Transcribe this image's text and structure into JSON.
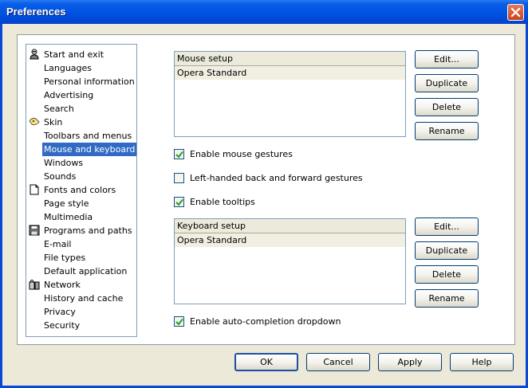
{
  "window": {
    "title": "Preferences"
  },
  "tree": {
    "items": [
      {
        "label": "Start and exit",
        "icon": "person-icon"
      },
      {
        "label": "Languages"
      },
      {
        "label": "Personal information"
      },
      {
        "label": "Advertising"
      },
      {
        "label": "Search"
      },
      {
        "label": "Skin",
        "icon": "skin-icon"
      },
      {
        "label": "Toolbars and menus"
      },
      {
        "label": "Mouse and keyboard",
        "selected": true
      },
      {
        "label": "Windows"
      },
      {
        "label": "Sounds"
      },
      {
        "label": "Fonts and colors",
        "icon": "page-icon"
      },
      {
        "label": "Page style"
      },
      {
        "label": "Multimedia"
      },
      {
        "label": "Programs and paths",
        "icon": "disk-icon"
      },
      {
        "label": "E-mail"
      },
      {
        "label": "File types"
      },
      {
        "label": "Default application"
      },
      {
        "label": "Network",
        "icon": "network-lock-icon"
      },
      {
        "label": "History and cache"
      },
      {
        "label": "Privacy"
      },
      {
        "label": "Security"
      }
    ]
  },
  "mouse": {
    "header": "Mouse setup",
    "selected": "Opera Standard",
    "buttons": {
      "edit": "Edit...",
      "duplicate": "Duplicate",
      "delete": "Delete",
      "rename": "Rename"
    }
  },
  "options": {
    "gestures": {
      "label": "Enable mouse gestures",
      "checked": true
    },
    "lefthanded": {
      "label": "Left-handed back and forward gestures",
      "checked": false
    },
    "tooltips": {
      "label": "Enable tooltips",
      "checked": true
    },
    "autocomplete": {
      "label": "Enable auto-completion dropdown",
      "checked": true
    }
  },
  "keyboard": {
    "header": "Keyboard setup",
    "selected": "Opera Standard",
    "buttons": {
      "edit": "Edit...",
      "duplicate": "Duplicate",
      "delete": "Delete",
      "rename": "Rename"
    }
  },
  "footer": {
    "ok": "OK",
    "cancel": "Cancel",
    "apply": "Apply",
    "help": "Help"
  },
  "colors": {
    "selection": "#316ac5",
    "titlebar": "#0053e1",
    "close": "#c44522"
  }
}
